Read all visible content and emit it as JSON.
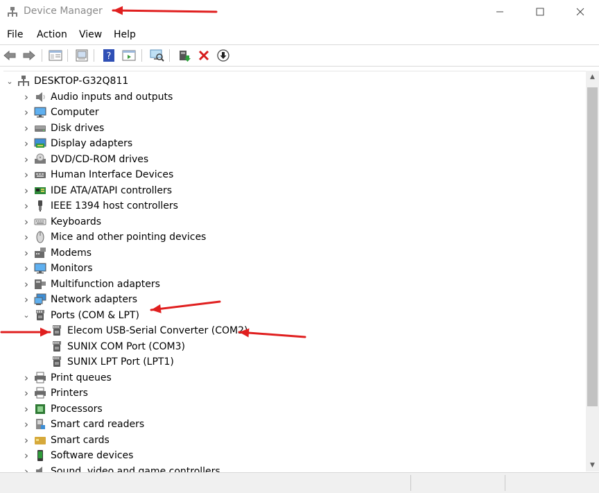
{
  "window": {
    "title": "Device Manager",
    "controls": [
      "minimize",
      "maximize",
      "close"
    ]
  },
  "menu": {
    "items": [
      "File",
      "Action",
      "View",
      "Help"
    ]
  },
  "toolbar": {
    "icons": [
      "back-arrow-icon",
      "forward-arrow-icon",
      "properties-icon",
      "update-list-icon",
      "help-icon",
      "action-pane-icon",
      "scan-hardware-icon",
      "update-driver-icon",
      "uninstall-device-icon",
      "disable-device-icon"
    ]
  },
  "tree": {
    "root": "DESKTOP-G32Q811",
    "categories": [
      {
        "label": "Audio inputs and outputs",
        "icon": "speaker-icon"
      },
      {
        "label": "Computer",
        "icon": "monitor-icon"
      },
      {
        "label": "Disk drives",
        "icon": "disk-drive-icon"
      },
      {
        "label": "Display adapters",
        "icon": "display-adapter-icon"
      },
      {
        "label": "DVD/CD-ROM drives",
        "icon": "dvd-drive-icon"
      },
      {
        "label": "Human Interface Devices",
        "icon": "hid-icon"
      },
      {
        "label": "IDE ATA/ATAPI controllers",
        "icon": "ide-controller-icon"
      },
      {
        "label": "IEEE 1394 host controllers",
        "icon": "ieee1394-icon"
      },
      {
        "label": "Keyboards",
        "icon": "keyboard-icon"
      },
      {
        "label": "Mice and other pointing devices",
        "icon": "mouse-icon"
      },
      {
        "label": "Modems",
        "icon": "modem-icon"
      },
      {
        "label": "Monitors",
        "icon": "monitor-icon"
      },
      {
        "label": "Multifunction adapters",
        "icon": "multifunction-icon"
      },
      {
        "label": "Network adapters",
        "icon": "network-adapter-icon"
      },
      {
        "label": "Ports (COM & LPT)",
        "icon": "port-icon",
        "expanded": true,
        "children": [
          {
            "label": "Elecom USB-Serial Converter (COM2)",
            "icon": "port-icon"
          },
          {
            "label": "SUNIX COM Port (COM3)",
            "icon": "port-icon"
          },
          {
            "label": "SUNIX LPT Port (LPT1)",
            "icon": "port-icon"
          }
        ]
      },
      {
        "label": "Print queues",
        "icon": "printer-icon"
      },
      {
        "label": "Printers",
        "icon": "printer-icon"
      },
      {
        "label": "Processors",
        "icon": "processor-icon"
      },
      {
        "label": "Smart card readers",
        "icon": "smart-card-reader-icon"
      },
      {
        "label": "Smart cards",
        "icon": "smart-card-icon"
      },
      {
        "label": "Software devices",
        "icon": "software-device-icon"
      },
      {
        "label": "Sound, video and game controllers",
        "icon": "sound-controller-icon"
      }
    ]
  },
  "annotations": {
    "arrow_color": "#e01f1f"
  }
}
